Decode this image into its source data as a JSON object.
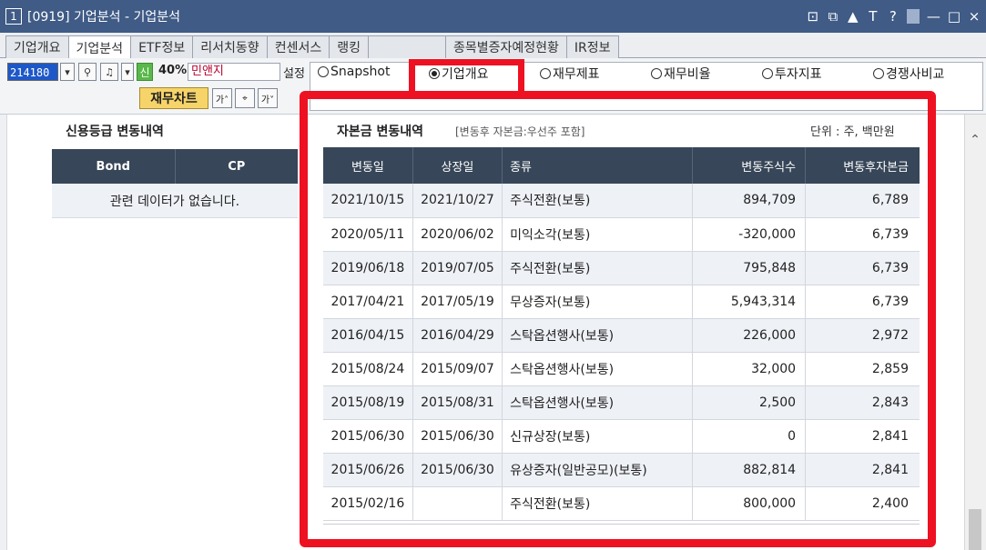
{
  "window": {
    "number": "1",
    "title": "[0919] 기업분석 - 기업분석",
    "controls": [
      "⊡",
      "⧉",
      "🖈",
      "T",
      "?",
      "—",
      "□",
      "×"
    ]
  },
  "tabs": [
    {
      "label": "기업개요",
      "active": false
    },
    {
      "label": "기업분석",
      "active": true
    },
    {
      "label": "ETF정보",
      "active": false
    },
    {
      "label": "리서치동향",
      "active": false
    },
    {
      "label": "컨센서스",
      "active": false
    },
    {
      "label": "랭킹",
      "active": false
    },
    {
      "label": "",
      "active": false
    },
    {
      "label": "종목별증자예정현황",
      "active": false
    },
    {
      "label": "IR정보",
      "active": false
    }
  ],
  "toolbar": {
    "stock_code": "214180",
    "sin_badge": "신",
    "margin_pct": "40%",
    "company_name": "민앤지",
    "setting_label": "설정",
    "chart_button": "재무차트"
  },
  "view_options": {
    "selected": "기업개요",
    "row1": [
      "Snapshot",
      "기업개요",
      "재무제표",
      "재무비율",
      "투자지표",
      "경쟁사비교"
    ]
  },
  "credit": {
    "title": "신용등급 변동내역",
    "headers": [
      "Bond",
      "CP"
    ],
    "empty_message": "관련 데이터가 없습니다."
  },
  "capital": {
    "title": "자본금 변동내역",
    "subtitle": "[변동후 자본금:우선주 포함]",
    "unit": "단위 : 주, 백만원",
    "headers": [
      "변동일",
      "상장일",
      "종류",
      "변동주식수",
      "변동후자본금"
    ],
    "rows": [
      [
        "2021/10/15",
        "2021/10/27",
        "주식전환(보통)",
        "894,709",
        "6,789"
      ],
      [
        "2020/05/11",
        "2020/06/02",
        "미익소각(보통)",
        "-320,000",
        "6,739"
      ],
      [
        "2019/06/18",
        "2019/07/05",
        "주식전환(보통)",
        "795,848",
        "6,739"
      ],
      [
        "2017/04/21",
        "2017/05/19",
        "무상증자(보통)",
        "5,943,314",
        "6,739"
      ],
      [
        "2016/04/15",
        "2016/04/29",
        "스탁옵션행사(보통)",
        "226,000",
        "2,972"
      ],
      [
        "2015/08/24",
        "2015/09/07",
        "스탁옵션행사(보통)",
        "32,000",
        "2,859"
      ],
      [
        "2015/08/19",
        "2015/08/31",
        "스탁옵션행사(보통)",
        "2,500",
        "2,843"
      ],
      [
        "2015/06/30",
        "2015/06/30",
        "신규상장(보통)",
        "0",
        "2,841"
      ],
      [
        "2015/06/26",
        "2015/06/30",
        "유상증자(일반공모)(보통)",
        "882,814",
        "2,841"
      ],
      [
        "2015/02/16",
        "",
        "주식전환(보통)",
        "800,000",
        "2,400"
      ]
    ]
  },
  "colors": {
    "titlebar": "#3f5b86",
    "table_header": "#374658",
    "highlight": "#ee1122",
    "chart_button": "#f7d46a"
  }
}
